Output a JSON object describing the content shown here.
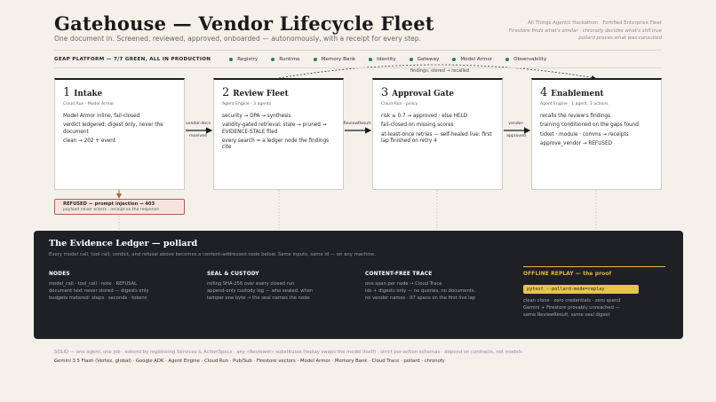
{
  "header": {
    "title": "Gatehouse — Vendor Lifecycle Fleet",
    "subtitle": "One document in. Screened, reviewed, approved, onboarded — autonomously, with a receipt for every step.",
    "hackathon": "All Things Agentic Hackathon · Fortified Enterprise Fleet",
    "tagline1": "Firestore finds what's similar · chronofy decides what's still true",
    "tagline2": "pollard proves what was consulted"
  },
  "platform": {
    "label": "GEAP PLATFORM — 7/7 GREEN, ALL IN PRODUCTION",
    "items": [
      "Registry",
      "Runtime",
      "Memory Bank",
      "Identity",
      "Gateway",
      "Model Armor",
      "Observability"
    ],
    "status_color": "#2e7d4f"
  },
  "findings_label": "findings: stored → recalled",
  "stages": [
    {
      "num": "1",
      "name": "Intake",
      "meta": "Cloud Run · Model Armor",
      "lines": [
        "Model Armor inline, fail-closed",
        "verdict ledgered: digest only, never the document",
        "clean → 202 + event"
      ]
    },
    {
      "num": "2",
      "name": "Review Fleet",
      "meta": "Agent Engine · 3 agents",
      "lines": [
        "security → DPA → synthesis",
        "validity-gated retrieval: stale → pruned → EVIDENCE-STALE filed",
        "every search = a ledger node the findings cite"
      ]
    },
    {
      "num": "3",
      "name": "Approval Gate",
      "meta": "Cloud Run · policy",
      "lines": [
        "risk ≤ 0.7 → approved · else HELD",
        "fail-closed on missing scores",
        "at-least-once retries — self-healed live: first lap finished on retry 4"
      ]
    },
    {
      "num": "4",
      "name": "Enablement",
      "meta": "Agent Engine · 1 agent, 3 actions",
      "lines": [
        "recalls the review's findings",
        "training conditioned on the gaps found",
        "ticket · module · comms → receipts",
        "approve_vendor → REFUSED"
      ]
    }
  ],
  "arrows": [
    {
      "top": "vendor-docs",
      "bottom": "received"
    },
    {
      "top": "ReviewResult",
      "bottom": ""
    },
    {
      "top": "vendor-",
      "bottom": "approved"
    }
  ],
  "refused": {
    "line1": "REFUSED — prompt injection → 403",
    "line2": "payload never enters · receipt on the response",
    "border_color": "#b85a4e"
  },
  "ledger": {
    "title": "The Evidence Ledger — pollard",
    "subtitle": "Every model call, tool call, verdict, and refusal above becomes a content-addressed node below. Same inputs, same id — on any machine.",
    "columns": [
      {
        "heading": "NODES",
        "lines": [
          "model_call · tool_call · note · REFUSAL",
          "document text never stored — digests only",
          "budgets metered: steps · seconds · tokens"
        ]
      },
      {
        "heading": "SEAL & CUSTODY",
        "lines": [
          "rolling SHA-256 over every closed run",
          "append-only custody log — who sealed, when",
          "tamper one byte → the seal names the node"
        ]
      },
      {
        "heading": "CONTENT-FREE TRACE",
        "lines": [
          "one span per node → Cloud Trace",
          "ids + digests only — no queries, no documents,",
          "no vendor names · 97 spans on the first live lap"
        ]
      }
    ],
    "replay": {
      "heading": "OFFLINE REPLAY — the proof",
      "command": "pytest --pollard-mode=replay",
      "lines": [
        "clean clone · zero credentials · zero spend",
        "Gemini + Firestore provably unreached —",
        "same ReviewResult, same seal digest"
      ],
      "accent": "#e7b942"
    }
  },
  "footer": {
    "line1": "SOLID — one agent, one job · extend by registering Services & ActionSpecs · any «Reviewer» substitutes (replay swaps the model itself) · strict per-action schemas · depend on contracts, not models",
    "line2": "Gemini 3.5 Flash (Vertex, global) · Google ADK · Agent Engine · Cloud Run · Pub/Sub · Firestore vectors · Model Armor · Memory Bank · Cloud Trace · pollard · chronofy"
  }
}
